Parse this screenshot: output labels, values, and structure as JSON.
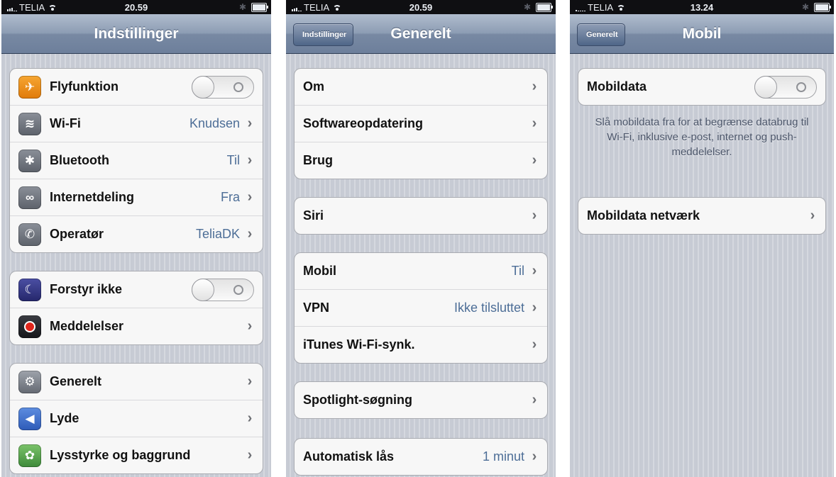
{
  "colors": {
    "value_blue": "#4d6e97",
    "nav_blue": "#6d7f9b",
    "background": "#c7cbd4"
  },
  "screens": [
    {
      "status": {
        "carrier": "TELIA",
        "time": "20.59"
      },
      "title": "Indstillinger",
      "groups": [
        [
          {
            "label": "Flyfunktion",
            "icon": "airplane-icon",
            "toggle": "off"
          },
          {
            "label": "Wi-Fi",
            "icon": "wifi-icon",
            "value": "Knudsen"
          },
          {
            "label": "Bluetooth",
            "icon": "bluetooth-icon",
            "value": "Til"
          },
          {
            "label": "Internetdeling",
            "icon": "chain-link-icon",
            "value": "Fra"
          },
          {
            "label": "Operatør",
            "icon": "phone-icon",
            "value": "TeliaDK"
          }
        ],
        [
          {
            "label": "Forstyr ikke",
            "icon": "moon-icon",
            "toggle": "off"
          },
          {
            "label": "Meddelelser",
            "icon": "notifications-icon"
          }
        ],
        [
          {
            "label": "Generelt",
            "icon": "gear-icon"
          },
          {
            "label": "Lyde",
            "icon": "speaker-icon"
          },
          {
            "label": "Lysstyrke og baggrund",
            "icon": "flower-icon"
          }
        ]
      ]
    },
    {
      "status": {
        "carrier": "TELIA",
        "time": "20.59"
      },
      "title": "Generelt",
      "back": "Indstillinger",
      "groups": [
        [
          {
            "label": "Om"
          },
          {
            "label": "Softwareopdatering"
          },
          {
            "label": "Brug"
          }
        ],
        [
          {
            "label": "Siri"
          }
        ],
        [
          {
            "label": "Mobil",
            "value": "Til"
          },
          {
            "label": "VPN",
            "value": "Ikke tilsluttet"
          },
          {
            "label": "iTunes Wi-Fi-synk."
          }
        ],
        [
          {
            "label": "Spotlight-søgning"
          }
        ],
        [
          {
            "label": "Automatisk lås",
            "value": "1 minut"
          }
        ]
      ]
    },
    {
      "status": {
        "carrier": "TELIA",
        "time": "13.24"
      },
      "title": "Mobil",
      "back": "Generelt",
      "groups": [
        [
          {
            "label": "Mobildata",
            "toggle": "off"
          }
        ],
        [
          {
            "label": "Mobildata netværk"
          }
        ]
      ],
      "note": "Slå mobildata fra for at begrænse databrug til Wi-Fi, inklusive e-post, internet og push-meddelelser."
    }
  ]
}
